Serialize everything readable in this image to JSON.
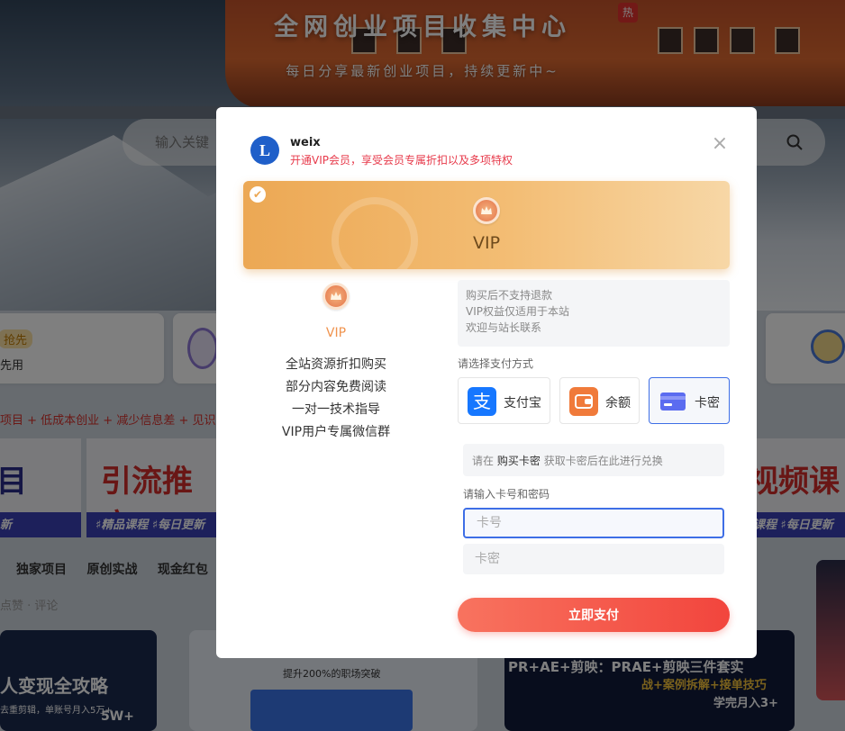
{
  "background": {
    "hero_title": "全网创业项目收集中心",
    "hot_badge": "热",
    "hero_subtitle": "每日分享最新创业项目，持续更新中~",
    "search_placeholder": "输入关键",
    "tag_qiang": "抢先",
    "tag_xianyong": "先用",
    "marquee": "项目 + 低成本创业 + 减少信息差 + 见识",
    "banner_left_big": "目",
    "banner_left_sub": "新",
    "banner_mid_big": "引流推广",
    "banner_mid_stripe": "♯精品课程 ♯每日更新",
    "banner_right_big": "视频课",
    "banner_right_stripe": "课程 ♯每日更新",
    "nav": [
      "独家项目",
      "原创实战",
      "现金红包"
    ],
    "meta": "点赞 · 评论",
    "thumb1_title": "人变现全攻略",
    "thumb1_sub": "去重剪辑，单账号月入5万+",
    "thumb1_num": "5W+",
    "thumb2_title": "提升200%的职场突破",
    "thumb3_title": "PR+AE+剪映：PRAE+剪映三件套实",
    "thumb3_line2": "战+案例拆解+接单技巧",
    "thumb3_line3": "学完月入3+"
  },
  "modal": {
    "brand": "weix",
    "logo_letter": "L",
    "description": "开通VIP会员，享受会员专属折扣以及多项特权",
    "close_icon": "×",
    "plan": {
      "name": "VIP",
      "selected_check": "✔"
    },
    "left_vip_label": "VIP",
    "benefits": [
      "全站资源折扣购买",
      "部分内容免费阅读",
      "一对一技术指导",
      "VIP用户专属微信群"
    ],
    "notice": [
      "购买后不支持退款",
      "VIP权益仅适用于本站",
      "欢迎与站长联系"
    ],
    "pay_method_label": "请选择支付方式",
    "pay_methods": [
      {
        "label": "支付宝",
        "icon": "alipay-icon",
        "color": "#1677ff",
        "selected": false
      },
      {
        "label": "余额",
        "icon": "wallet-icon",
        "color": "#f07a3a",
        "selected": false
      },
      {
        "label": "卡密",
        "icon": "card-icon",
        "color": "#5b6cf0",
        "selected": true
      }
    ],
    "redeem_hint": {
      "prefix": "请在",
      "link": "购买卡密",
      "suffix": "获取卡密后在此进行兑换"
    },
    "card_input_label": "请输入卡号和密码",
    "card_number_placeholder": "卡号",
    "card_password_placeholder": "卡密",
    "pay_button": "立即支付"
  }
}
